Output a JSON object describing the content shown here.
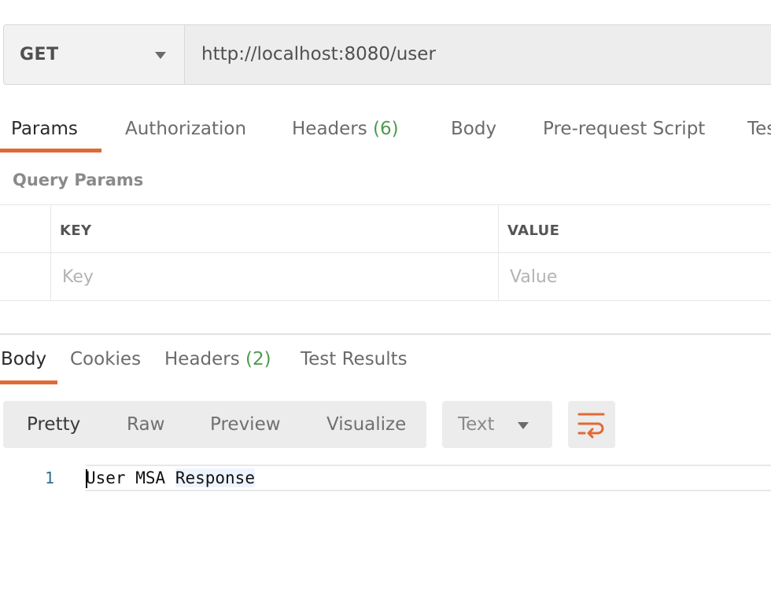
{
  "request": {
    "method": "GET",
    "url": "http://localhost:8080/user"
  },
  "request_tabs": [
    {
      "label": "Params",
      "count": "",
      "active": true
    },
    {
      "label": "Authorization",
      "count": "",
      "active": false
    },
    {
      "label": "Headers",
      "count": "(6)",
      "active": false
    },
    {
      "label": "Body",
      "count": "",
      "active": false
    },
    {
      "label": "Pre-request Script",
      "count": "",
      "active": false
    },
    {
      "label": "Tes",
      "count": "",
      "active": false
    }
  ],
  "query_params": {
    "title": "Query Params",
    "columns": [
      "KEY",
      "VALUE"
    ],
    "placeholders": [
      "Key",
      "Value"
    ]
  },
  "response_tabs": [
    {
      "label": "Body",
      "count": "",
      "active": true
    },
    {
      "label": "Cookies",
      "count": "",
      "active": false
    },
    {
      "label": "Headers",
      "count": "(2)",
      "active": false
    },
    {
      "label": "Test Results",
      "count": "",
      "active": false
    }
  ],
  "format_options": [
    {
      "label": "Pretty",
      "active": true
    },
    {
      "label": "Raw",
      "active": false
    },
    {
      "label": "Preview",
      "active": false
    },
    {
      "label": "Visualize",
      "active": false
    }
  ],
  "response_type": "Text",
  "response_body": {
    "line_number": "1",
    "words": [
      "User",
      "MSA",
      "Response"
    ]
  },
  "colors": {
    "accent": "#e06a35",
    "count": "#4f9a4f",
    "toolbar": "#ececec"
  },
  "icons": {
    "method_dropdown": "chevron-down-icon",
    "type_dropdown": "chevron-down-icon",
    "wrap": "word-wrap-icon"
  }
}
